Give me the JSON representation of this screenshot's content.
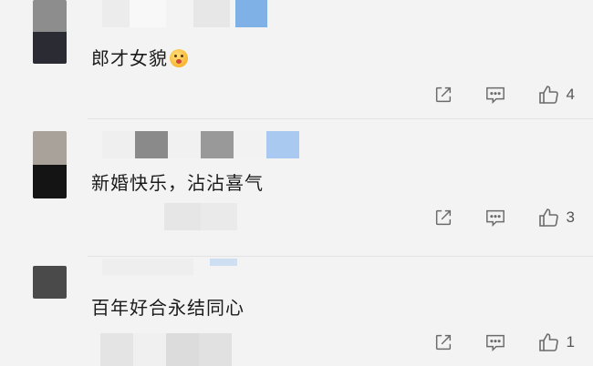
{
  "comments": [
    {
      "text": "郎才女貌",
      "emoji": "kissing-face-emoji",
      "like_count": "4"
    },
    {
      "text": "新婚快乐，沾沾喜气",
      "like_count": "3"
    },
    {
      "text": "百年好合永结同心",
      "like_count": "1"
    }
  ],
  "icons": {
    "share": "share-square-icon",
    "reply": "comment-bubble-icon",
    "like": "thumbs-up-icon"
  },
  "colors": {
    "background": "#f3f3f3",
    "text": "#1b1b1b",
    "icon": "#6b6b6b",
    "divider": "#e2e2e2"
  }
}
